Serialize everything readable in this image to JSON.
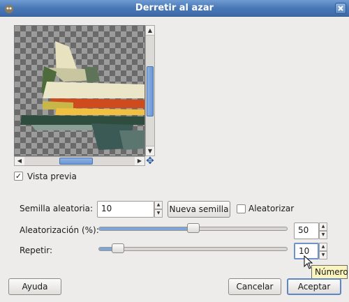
{
  "window": {
    "title": "Derretir al azar"
  },
  "preview": {
    "checkbox_label": "Vista previa",
    "checked": true
  },
  "seed": {
    "label": "Semilla aleatoria:",
    "value": "10",
    "new_seed_button": "Nueva semilla",
    "randomize_label": "Aleatorizar",
    "randomize_checked": false
  },
  "randomization": {
    "label": "Aleatorización (%):",
    "value": "50",
    "percent": 50
  },
  "repeat": {
    "label": "Repetir:",
    "value": "10",
    "fraction": 0.1
  },
  "tooltip": {
    "text": "Número"
  },
  "buttons": {
    "help": "Ayuda",
    "cancel": "Cancelar",
    "ok": "Aceptar"
  },
  "icons": [
    "gimp-app-icon",
    "close-icon",
    "navigate-icon",
    "checkmark-icon",
    "spin-up-icon",
    "spin-down-icon",
    "pointer-cursor-icon"
  ]
}
